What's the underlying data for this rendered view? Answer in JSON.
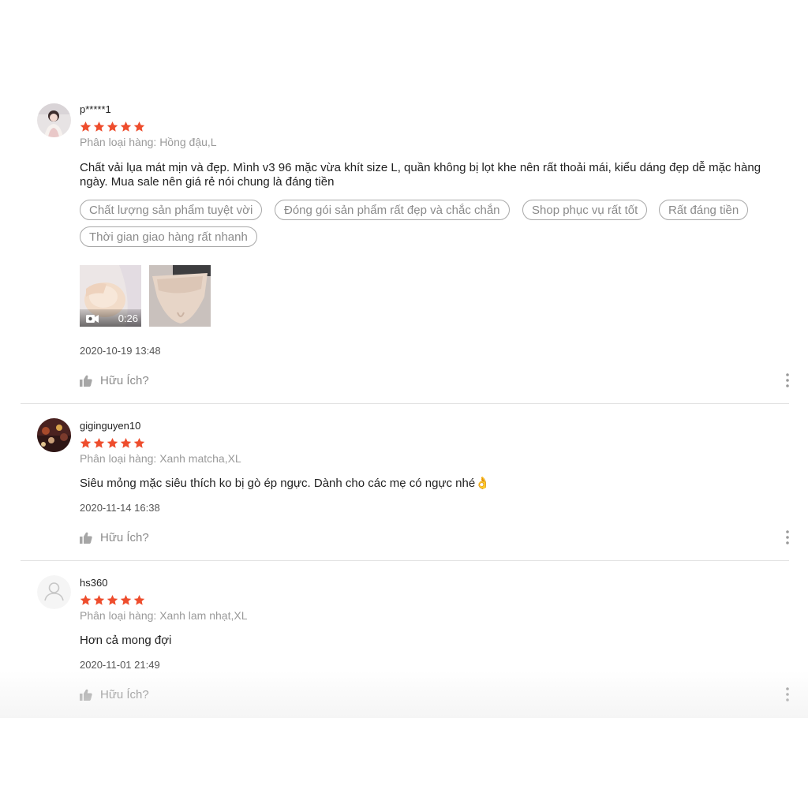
{
  "reviews": [
    {
      "username": "p*****1",
      "rating": 5,
      "variant": "Phân loại hàng: Hồng đậu,L",
      "content": "Chất vải lụa mát mịn và đẹp. Mình v3 96 mặc vừa khít size L, quần không bị lọt khe nên rất thoải mái, kiểu dáng đẹp dễ mặc hàng ngày. Mua sale nên giá rẻ nói chung là đáng tiền",
      "tags": [
        "Chất lượng sản phẩm tuyệt vời",
        "Đóng gói sản phẩm rất đẹp và chắc chắn",
        "Shop phục vụ rất tốt",
        "Rất đáng tiền",
        "Thời gian giao hàng rất nhanh"
      ],
      "media": [
        {
          "type": "video",
          "duration": "0:26",
          "icon": "video-camera-icon"
        },
        {
          "type": "image"
        }
      ],
      "timestamp": "2020-10-19 13:48",
      "helpful_label": "Hữu Ích?"
    },
    {
      "username": "giginguyen10",
      "rating": 5,
      "variant": "Phân loại hàng: Xanh matcha,XL",
      "content": "Siêu mỏng mặc siêu thích ko bị gò ép ngực. Dành cho các mẹ có ngực nhé👌",
      "timestamp": "2020-11-14 16:38",
      "helpful_label": "Hữu Ích?"
    },
    {
      "username": "hs360",
      "rating": 5,
      "variant": "Phân loại hàng: Xanh lam nhạt,XL",
      "content": "Hơn cả mong đợi",
      "timestamp": "2020-11-01 21:49",
      "helpful_label": "Hữu Ích?"
    }
  ],
  "colors": {
    "star": "#ee4d2d",
    "muted_text": "#9a9a9a",
    "divider": "#e2e2e2"
  },
  "icons": {
    "star": "star-icon",
    "helpful": "thumbs-up-icon",
    "more": "more-vertical-icon",
    "default_avatar": "user-placeholder-icon"
  }
}
